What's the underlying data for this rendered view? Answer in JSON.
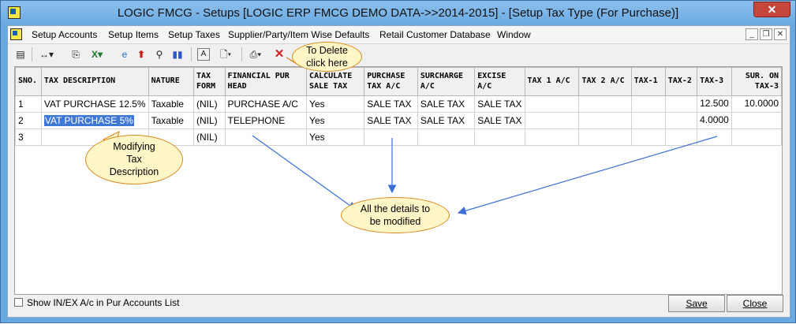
{
  "window": {
    "title": "LOGIC FMCG - Setups  [LOGIC ERP FMCG DEMO DATA->>2014-2015] - [Setup Tax Type (For Purchase)]"
  },
  "menu": {
    "items": [
      "Setup Accounts",
      "Setup Items",
      "Setup Taxes",
      "Supplier/Party/Item Wise Defaults",
      "Retail Customer Database",
      "Window"
    ]
  },
  "grid": {
    "headers": [
      "SNO.",
      "TAX DESCRIPTION",
      "NATURE",
      "TAX FORM",
      "FINANCIAL PUR HEAD",
      "CALCULATE SALE TAX",
      "PURCHASE TAX A/C",
      "SURCHARGE A/C",
      "EXCISE A/C",
      "TAX 1 A/C",
      "TAX 2 A/C",
      "TAX-1",
      "TAX-2",
      "TAX-3",
      "SUR. ON TAX-3"
    ],
    "rows": [
      [
        "1",
        "VAT PURCHASE 12.5%",
        "Taxable",
        "(NIL)",
        "PURCHASE A/C",
        "Yes",
        "SALE TAX",
        "SALE TAX",
        "SALE TAX",
        "",
        "",
        "",
        "",
        "12.500",
        "10.0000"
      ],
      [
        "2",
        "VAT PURCHASE 5%",
        "Taxable",
        "(NIL)",
        "TELEPHONE",
        "Yes",
        "SALE TAX",
        "SALE TAX",
        "SALE TAX",
        "",
        "",
        "",
        "",
        "4.0000",
        ""
      ],
      [
        "3",
        "",
        "",
        "(NIL)",
        "",
        "Yes",
        "",
        "",
        "",
        "",
        "",
        "",
        "",
        "",
        ""
      ]
    ]
  },
  "footer": {
    "checkbox_label": "Show IN/EX A/c in Pur Accounts List",
    "save_label": "Save",
    "close_label": "Close"
  },
  "callouts": {
    "delete": [
      "To Delete",
      "click here"
    ],
    "modify_desc": [
      "Modifying",
      "Tax",
      "Description"
    ],
    "all_details": [
      "All the details to",
      "be modified"
    ]
  },
  "colors": {
    "titlebar": "#6aa9e0",
    "selection": "#3f78d4",
    "callout_fill": "#fff6c8",
    "callout_border": "#d98a21",
    "arrow": "#3b6fd6"
  }
}
